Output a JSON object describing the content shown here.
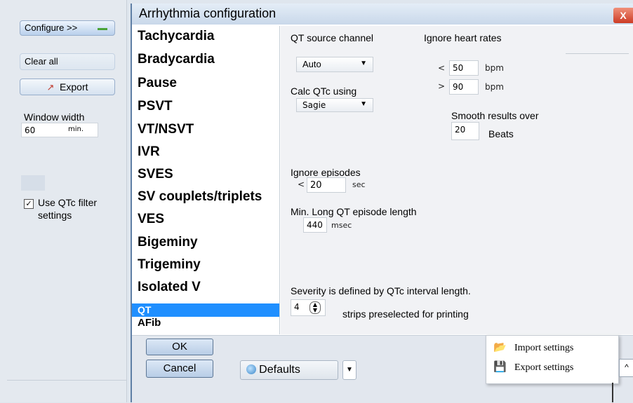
{
  "sidebar": {
    "configure_label": "Configure >>",
    "clear_label": "Clear all",
    "export_label": "Export",
    "window_width_label": "Window width",
    "window_width_value": "60",
    "window_width_unit": "min.",
    "qtc_filter_label_1": "Use QTc filter",
    "qtc_filter_label_2": "settings"
  },
  "dialog": {
    "title": "Arrhythmia configuration",
    "close_label": "X",
    "list_items": [
      "Tachycardia",
      "Bradycardia",
      "Pause",
      "PSVT",
      "VT/NSVT",
      "IVR",
      "SVES",
      "SV couplets/triplets",
      "VES",
      "Bigeminy",
      "Trigeminy",
      "Isolated V",
      "QT",
      "AFib"
    ],
    "selected_item": "QT",
    "qt": {
      "source_label": "QT source channel",
      "source_value": "Auto",
      "calc_label": "Calc QTc using",
      "calc_value": "Sagie",
      "ignore_hr_label": "Ignore heart rates",
      "lt_symbol": "<",
      "gt_symbol": ">",
      "hr_low": "50",
      "hr_high": "90",
      "bpm": "bpm",
      "smooth_label": "Smooth results over",
      "smooth_value": "20",
      "beats": "Beats",
      "ignore_episodes_label": "Ignore episodes",
      "ignore_episodes_value": "20",
      "sec": "sec",
      "min_long_label": "Min. Long QT episode length",
      "min_long_value": "440",
      "msec": "msec",
      "severity_label": "Severity is defined by QTc interval length.",
      "strips_value": "4",
      "strips_label": "strips preselected for printing"
    },
    "footer": {
      "ok_label": "OK",
      "cancel_label": "Cancel",
      "defaults_label": "Defaults"
    },
    "menu": {
      "import_label": "Import settings",
      "export_label": "Export settings"
    }
  },
  "colors": {
    "selection": "#1f8fff",
    "close": "#cc3b24"
  }
}
